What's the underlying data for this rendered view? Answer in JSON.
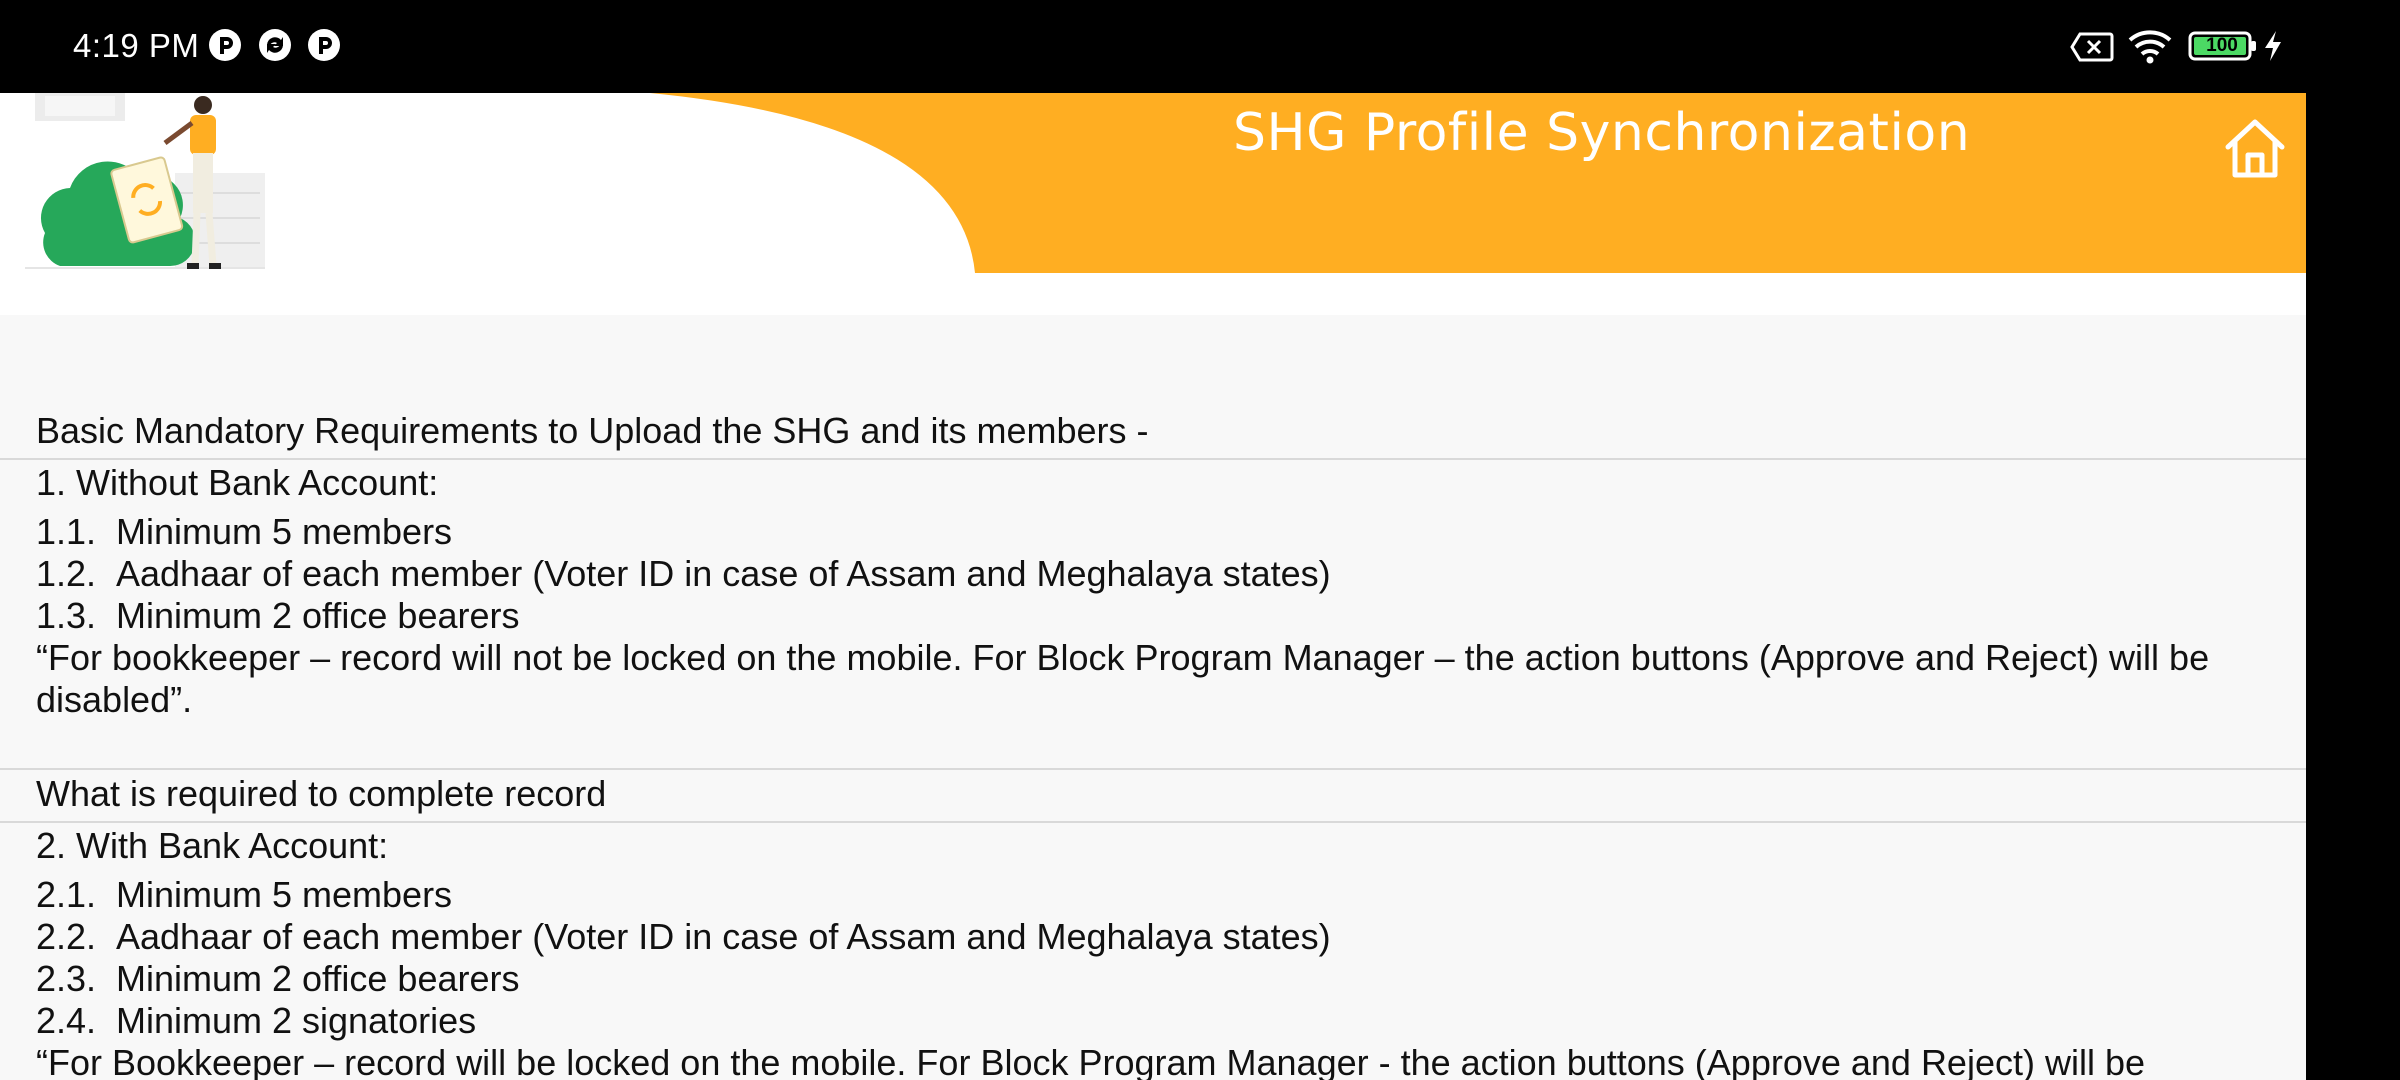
{
  "status_bar": {
    "time": "4:19 PM",
    "battery": "100",
    "icons": [
      "notification-icon-1",
      "sync-notification-icon",
      "notification-icon-2",
      "sim-off-icon",
      "wifi-icon",
      "battery-icon",
      "charging-icon"
    ]
  },
  "header": {
    "title": "SHG Profile Synchronization",
    "home_icon": "home-icon",
    "accent_color": "#ffae22"
  },
  "content": {
    "intro": "Basic Mandatory Requirements to Upload the SHG and its members -",
    "section1": {
      "heading": "1. Without Bank Account:",
      "items": [
        {
          "num": "1.1.",
          "text": "Minimum 5 members"
        },
        {
          "num": "1.2.",
          "text": "Aadhaar of each member (Voter ID in case of Assam and Meghalaya states)"
        },
        {
          "num": "1.3.",
          "text": "Minimum 2 office bearers"
        }
      ],
      "note": "“For bookkeeper – record will not be locked on the mobile. For Block Program Manager – the action buttons (Approve and Reject) will be disabled”."
    },
    "required_heading": "What is required to complete record",
    "section2": {
      "heading": "2. With Bank Account:",
      "items": [
        {
          "num": "2.1.",
          "text": "Minimum 5 members"
        },
        {
          "num": "2.2.",
          "text": "Aadhaar of each member (Voter ID in case of Assam and Meghalaya states)"
        },
        {
          "num": "2.3.",
          "text": "Minimum 2 office bearers"
        },
        {
          "num": "2.4.",
          "text": "Minimum 2 signatories"
        }
      ],
      "note": "“For Bookkeeper – record will be locked on the mobile. For Block Program Manager -  the action buttons (Approve and Reject) will be enabled”."
    }
  }
}
